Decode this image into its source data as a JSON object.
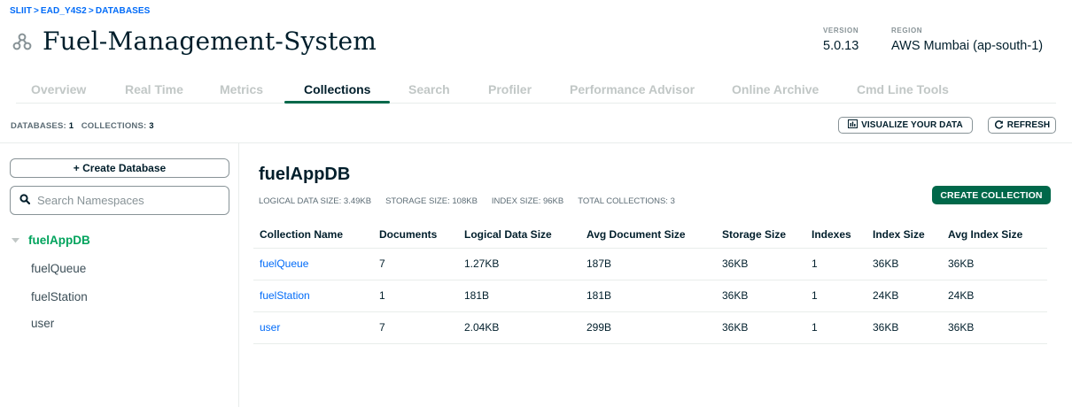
{
  "breadcrumb": {
    "org": "SLIIT",
    "project": "EAD_Y4S2",
    "page": "DATABASES",
    "separator": ">"
  },
  "cluster": {
    "name": "Fuel-Management-System",
    "icon": "cluster-icon"
  },
  "meta": {
    "version_label": "VERSION",
    "version_value": "5.0.13",
    "region_label": "REGION",
    "region_value": "AWS Mumbai (ap-south-1)"
  },
  "tabs": [
    {
      "label": "Overview"
    },
    {
      "label": "Real Time"
    },
    {
      "label": "Metrics"
    },
    {
      "label": "Collections",
      "active": true
    },
    {
      "label": "Search"
    },
    {
      "label": "Profiler"
    },
    {
      "label": "Performance Advisor"
    },
    {
      "label": "Online Archive"
    },
    {
      "label": "Cmd Line Tools"
    }
  ],
  "summary": {
    "databases_label": "DATABASES:",
    "databases_count": "1",
    "collections_label": "COLLECTIONS:",
    "collections_count": "3"
  },
  "toolbar": {
    "visualize_label": "VISUALIZE YOUR DATA",
    "visualize_icon": "bar-chart-icon",
    "refresh_label": "REFRESH",
    "refresh_icon": "refresh-icon"
  },
  "sidebar": {
    "create_db_label": "+ Create Database",
    "search_placeholder": "Search Namespaces",
    "search_value": "",
    "database": {
      "name": "fuelAppDB",
      "expanded": true
    },
    "collections": [
      "fuelQueue",
      "fuelStation",
      "user"
    ]
  },
  "main": {
    "db_title": "fuelAppDB",
    "stats": {
      "logical": "LOGICAL DATA SIZE: 3.49KB",
      "storage": "STORAGE SIZE: 108KB",
      "index": "INDEX SIZE: 96KB",
      "total": "TOTAL COLLECTIONS: 3"
    },
    "create_collection_label": "CREATE COLLECTION",
    "table": {
      "headers": [
        "Collection Name",
        "Documents",
        "Logical Data Size",
        "Avg Document Size",
        "Storage Size",
        "Indexes",
        "Index Size",
        "Avg Index Size"
      ],
      "rows": [
        [
          "fuelQueue",
          "7",
          "1.27KB",
          "187B",
          "36KB",
          "1",
          "36KB",
          "36KB"
        ],
        [
          "fuelStation",
          "1",
          "181B",
          "181B",
          "36KB",
          "1",
          "24KB",
          "24KB"
        ],
        [
          "user",
          "7",
          "2.04KB",
          "299B",
          "36KB",
          "1",
          "36KB",
          "36KB"
        ]
      ]
    }
  },
  "colors": {
    "accent_green": "#00684a",
    "tree_green": "#00a35c",
    "link_blue": "#016bf8",
    "text_dark": "#001e2b",
    "muted": "#889397"
  }
}
